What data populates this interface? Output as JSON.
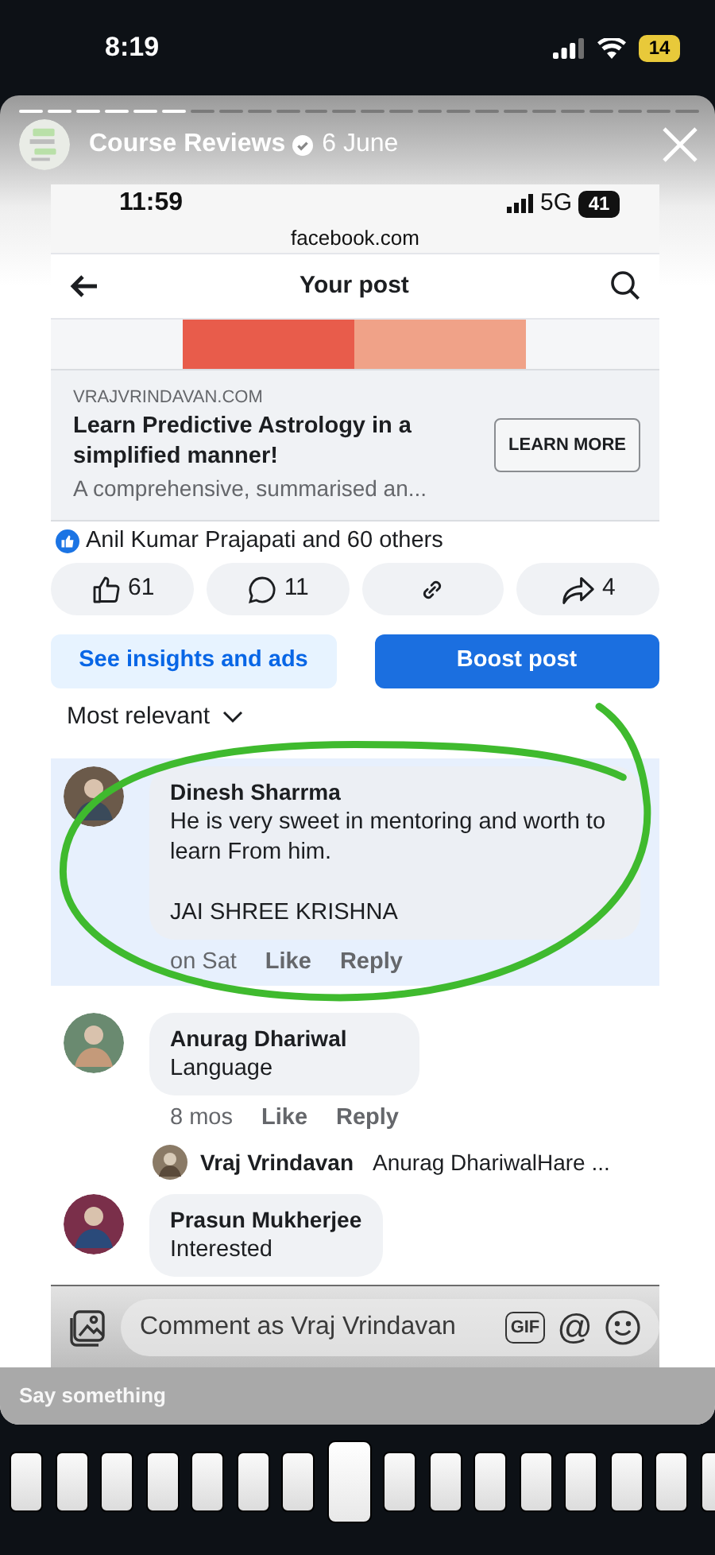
{
  "phone_status": {
    "time": "8:19",
    "battery": "14",
    "low_power": true
  },
  "story": {
    "progress": [
      {
        "viewed": true
      },
      {
        "viewed": true
      },
      {
        "viewed": true
      },
      {
        "viewed": true
      },
      {
        "viewed": true
      },
      {
        "viewed": true
      },
      {
        "viewed": false
      },
      {
        "viewed": false
      },
      {
        "viewed": false
      },
      {
        "viewed": false
      },
      {
        "viewed": false
      },
      {
        "viewed": false
      },
      {
        "viewed": false
      },
      {
        "viewed": false
      },
      {
        "viewed": false
      },
      {
        "viewed": false
      },
      {
        "viewed": false
      },
      {
        "viewed": false
      },
      {
        "viewed": false
      },
      {
        "viewed": false
      },
      {
        "viewed": false
      },
      {
        "viewed": false
      },
      {
        "viewed": false
      },
      {
        "viewed": false
      }
    ],
    "account": "Course Reviews",
    "verified": true,
    "date": "6 June",
    "caption_placeholder": "Say something"
  },
  "screenshot": {
    "status": {
      "time": "11:59",
      "network": "5G",
      "battery": "41"
    },
    "url": "facebook.com",
    "title": "Your post",
    "ad": {
      "domain": "VRAJVRINDAVAN.COM",
      "headline": "Learn Predictive Astrology in a simplified manner!",
      "description": "A comprehensive, summarised an...",
      "button": "LEARN MORE"
    },
    "reactions_summary": "Anil Kumar Prajapati and 60 others",
    "actions": [
      {
        "kind": "like",
        "count": "61"
      },
      {
        "kind": "comment",
        "count": "11"
      },
      {
        "kind": "link"
      },
      {
        "kind": "share",
        "count": "4"
      }
    ],
    "buttons": [
      {
        "label": "See insights and ads",
        "kind": "secondary"
      },
      {
        "label": "Boost post",
        "kind": "primary"
      }
    ],
    "sort": "Most relevant",
    "comments": [
      {
        "author": "Dinesh Sharrma",
        "paragraphs": [
          "He is very sweet in mentoring and worth to learn From him.",
          "JAI SHREE KRISHNA"
        ],
        "time": "on Sat",
        "like": "Like",
        "reply": "Reply",
        "highlighted": true,
        "circled": true
      },
      {
        "author": "Anurag Dhariwal",
        "paragraphs": [
          "Language"
        ],
        "time": "8 mos",
        "like": "Like",
        "reply": "Reply",
        "highlighted": false,
        "reply_preview": {
          "author": "Vraj Vrindavan",
          "text": "Anurag DhariwalHare ..."
        }
      },
      {
        "author": "Prasun Mukherjee",
        "paragraphs": [
          "Interested"
        ],
        "highlighted": false
      }
    ],
    "comment_field": {
      "placeholder": "Comment as Vraj Vrindavan",
      "gif": "GIF",
      "mention": "@"
    }
  },
  "thumbnails": [
    {
      "selected": false
    },
    {
      "selected": false
    },
    {
      "selected": false
    },
    {
      "selected": false
    },
    {
      "selected": false
    },
    {
      "selected": false
    },
    {
      "selected": false
    },
    {
      "selected": true
    },
    {
      "selected": false
    },
    {
      "selected": false
    },
    {
      "selected": false
    },
    {
      "selected": false
    },
    {
      "selected": false
    },
    {
      "selected": false
    },
    {
      "selected": false
    },
    {
      "selected": false
    }
  ]
}
